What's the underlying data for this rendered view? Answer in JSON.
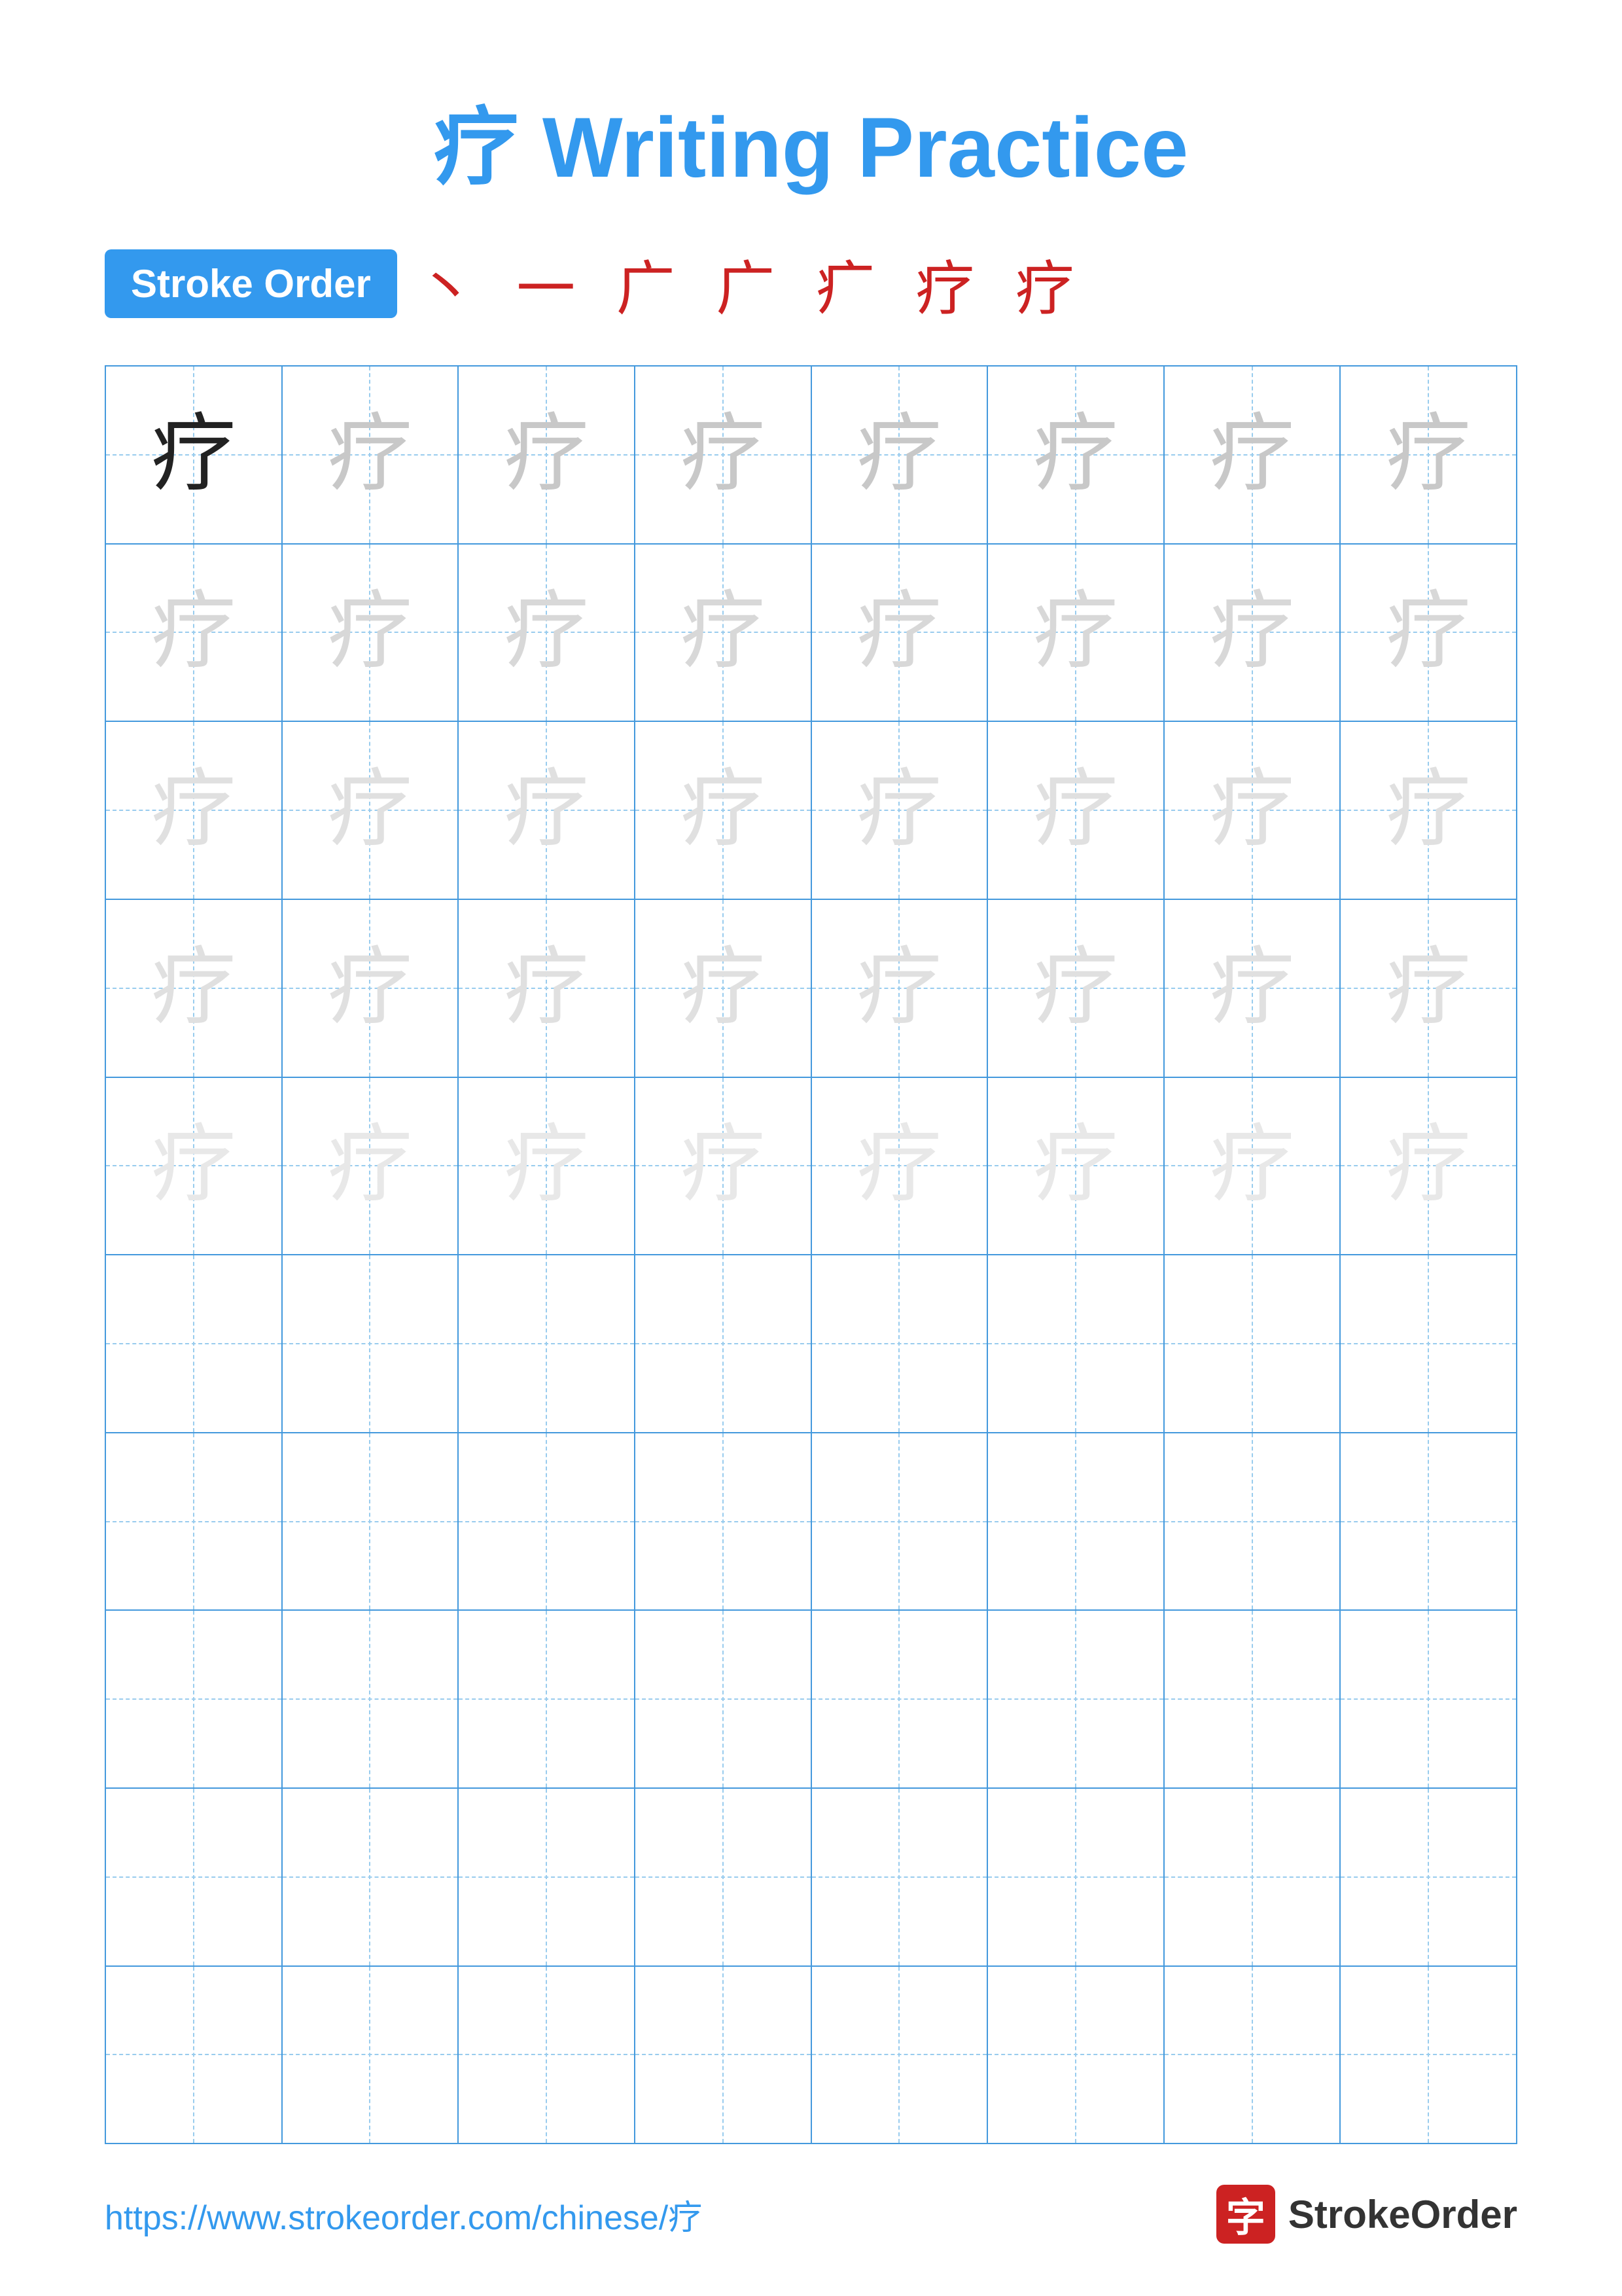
{
  "title": {
    "chinese": "疗",
    "english": "Writing Practice",
    "full": "疗 Writing Practice"
  },
  "stroke_order": {
    "badge_label": "Stroke Order",
    "sequence": "丶 一 广 广 疒 疗 疗"
  },
  "grid": {
    "rows": 10,
    "cols": 8,
    "character": "疗",
    "filled_rows": 5,
    "shade_levels": [
      "dark",
      "light-1",
      "light-1",
      "light-2",
      "light-2",
      "light-3",
      "light-3",
      "light-4"
    ]
  },
  "footer": {
    "url": "https://www.strokeorder.com/chinese/疗",
    "brand": "StrokeOrder",
    "brand_char": "字"
  }
}
